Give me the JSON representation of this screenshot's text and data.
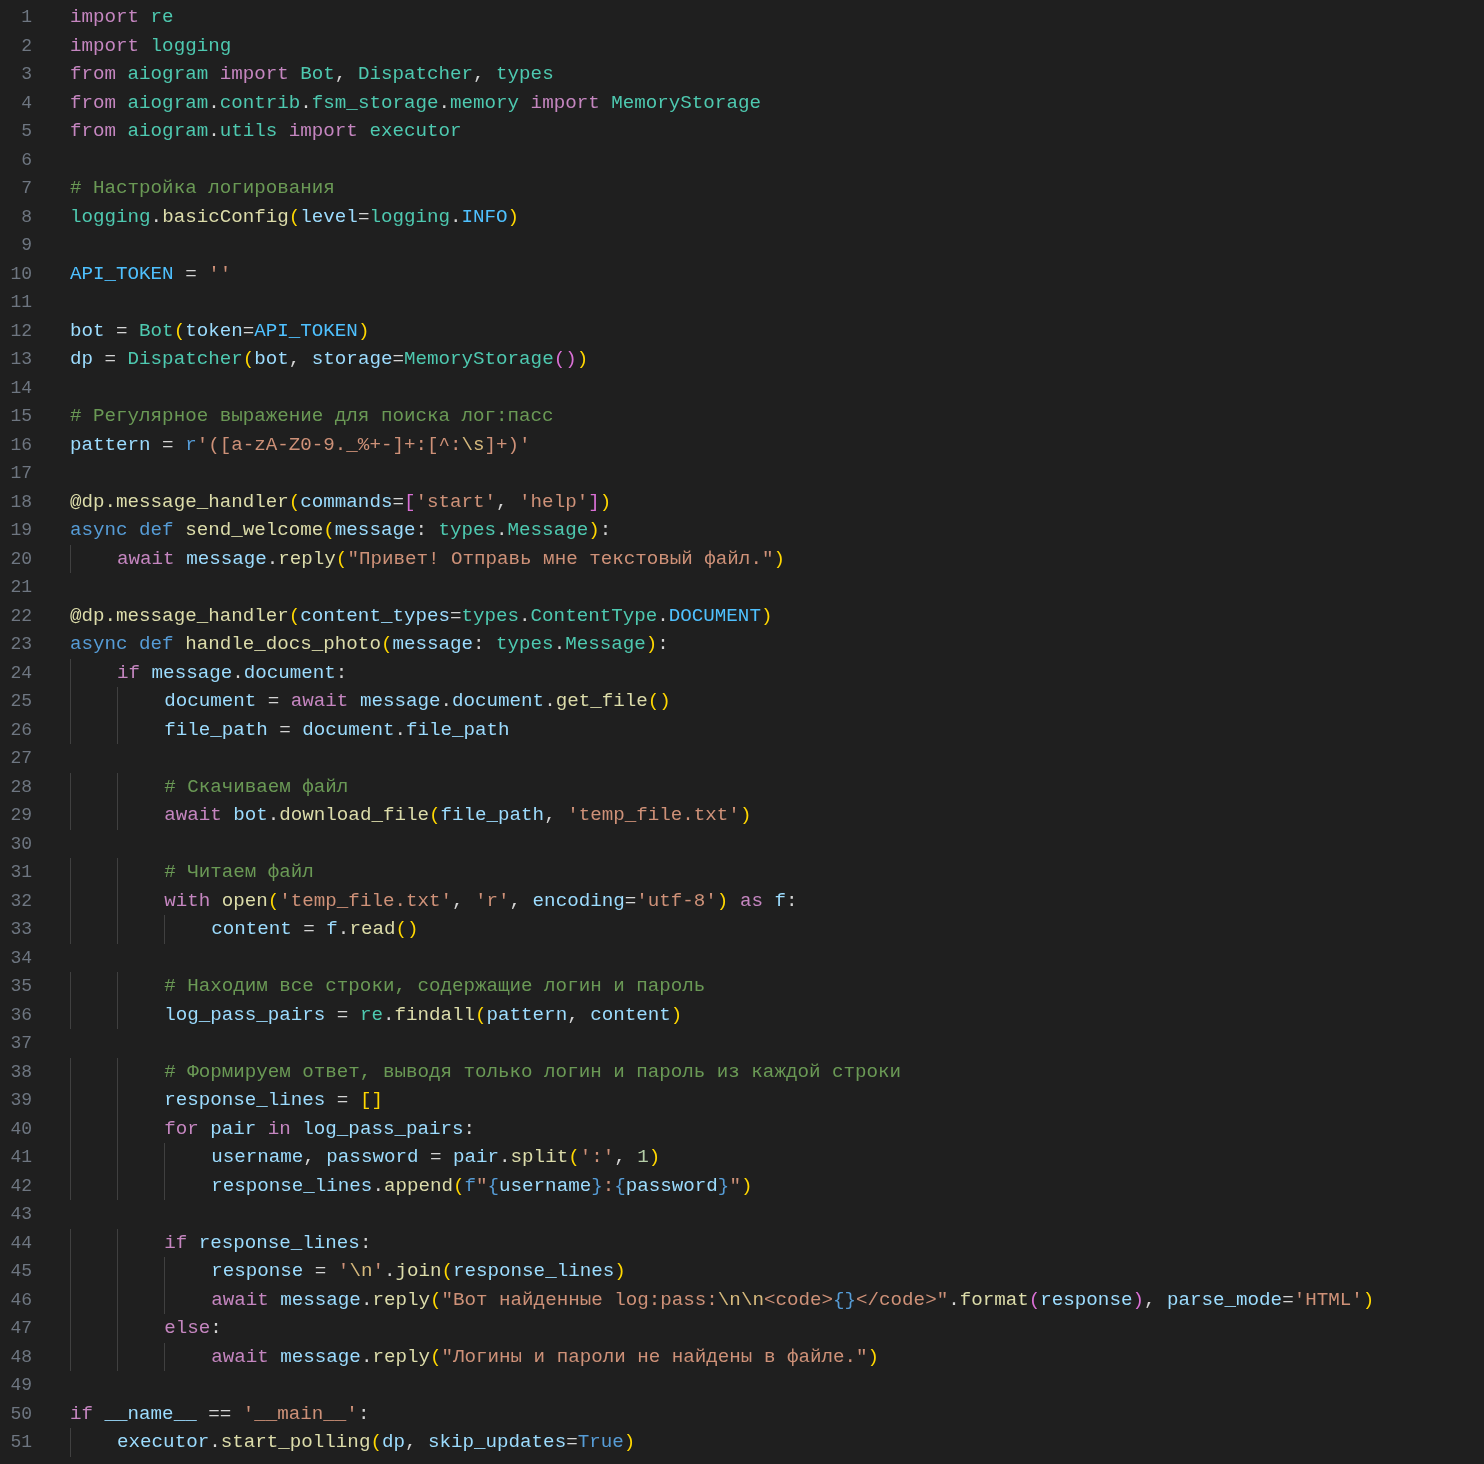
{
  "editor": {
    "lines": [
      {
        "number": "1",
        "tokens": [
          {
            "kind": "kw",
            "text": "import"
          },
          {
            "kind": "cls",
            "text": " re"
          }
        ]
      },
      {
        "number": "2",
        "tokens": [
          {
            "kind": "kw",
            "text": "import"
          },
          {
            "kind": "cls",
            "text": " logging"
          }
        ]
      },
      {
        "number": "3",
        "tokens": [
          {
            "kind": "kw",
            "text": "from"
          },
          {
            "kind": "cls",
            "text": " aiogram"
          },
          {
            "kind": "kw",
            "text": " import"
          },
          {
            "kind": "cls",
            "text": " Bot"
          },
          {
            "kind": "op",
            "text": ", "
          },
          {
            "kind": "cls",
            "text": "Dispatcher"
          },
          {
            "kind": "op",
            "text": ", "
          },
          {
            "kind": "cls",
            "text": "types"
          }
        ]
      },
      {
        "number": "4",
        "tokens": [
          {
            "kind": "kw",
            "text": "from"
          },
          {
            "kind": "cls",
            "text": " aiogram"
          },
          {
            "kind": "op",
            "text": "."
          },
          {
            "kind": "cls",
            "text": "contrib"
          },
          {
            "kind": "op",
            "text": "."
          },
          {
            "kind": "cls",
            "text": "fsm_storage"
          },
          {
            "kind": "op",
            "text": "."
          },
          {
            "kind": "cls",
            "text": "memory"
          },
          {
            "kind": "kw",
            "text": " import"
          },
          {
            "kind": "cls",
            "text": " MemoryStorage"
          }
        ]
      },
      {
        "number": "5",
        "tokens": [
          {
            "kind": "kw",
            "text": "from"
          },
          {
            "kind": "cls",
            "text": " aiogram"
          },
          {
            "kind": "op",
            "text": "."
          },
          {
            "kind": "cls",
            "text": "utils"
          },
          {
            "kind": "kw",
            "text": " import"
          },
          {
            "kind": "cls",
            "text": " executor"
          }
        ]
      },
      {
        "number": "6"
      },
      {
        "number": "7",
        "tokens": [
          {
            "kind": "cmt",
            "text": "# Настройка логирования"
          }
        ]
      },
      {
        "number": "8",
        "tokens": [
          {
            "kind": "cls",
            "text": "logging"
          },
          {
            "kind": "op",
            "text": "."
          },
          {
            "kind": "fn",
            "text": "basicConfig"
          },
          {
            "kind": "br1",
            "text": "("
          },
          {
            "kind": "var",
            "text": "level"
          },
          {
            "kind": "op",
            "text": "="
          },
          {
            "kind": "cls",
            "text": "logging"
          },
          {
            "kind": "op",
            "text": "."
          },
          {
            "kind": "const",
            "text": "INFO"
          },
          {
            "kind": "br1",
            "text": ")"
          }
        ]
      },
      {
        "number": "9"
      },
      {
        "number": "10",
        "tokens": [
          {
            "kind": "const",
            "text": "API_TOKEN"
          },
          {
            "kind": "op",
            "text": " = "
          },
          {
            "kind": "str",
            "text": "''"
          }
        ]
      },
      {
        "number": "11"
      },
      {
        "number": "12",
        "tokens": [
          {
            "kind": "var",
            "text": "bot"
          },
          {
            "kind": "op",
            "text": " = "
          },
          {
            "kind": "cls",
            "text": "Bot"
          },
          {
            "kind": "br1",
            "text": "("
          },
          {
            "kind": "var",
            "text": "token"
          },
          {
            "kind": "op",
            "text": "="
          },
          {
            "kind": "const",
            "text": "API_TOKEN"
          },
          {
            "kind": "br1",
            "text": ")"
          }
        ]
      },
      {
        "number": "13",
        "tokens": [
          {
            "kind": "var",
            "text": "dp"
          },
          {
            "kind": "op",
            "text": " = "
          },
          {
            "kind": "cls",
            "text": "Dispatcher"
          },
          {
            "kind": "br1",
            "text": "("
          },
          {
            "kind": "var",
            "text": "bot"
          },
          {
            "kind": "op",
            "text": ", "
          },
          {
            "kind": "var",
            "text": "storage"
          },
          {
            "kind": "op",
            "text": "="
          },
          {
            "kind": "cls",
            "text": "MemoryStorage"
          },
          {
            "kind": "br2",
            "text": "()"
          },
          {
            "kind": "br1",
            "text": ")"
          }
        ]
      },
      {
        "number": "14"
      },
      {
        "number": "15",
        "tokens": [
          {
            "kind": "cmt",
            "text": "# Регулярное выражение для поиска лог:пасс"
          }
        ]
      },
      {
        "number": "16",
        "tokens": [
          {
            "kind": "var",
            "text": "pattern"
          },
          {
            "kind": "op",
            "text": " = "
          },
          {
            "kind": "store",
            "text": "r"
          },
          {
            "kind": "str",
            "text": "'([a-zA-Z0-9._%+-]+:[^:"
          },
          {
            "kind": "esc",
            "text": "\\s"
          },
          {
            "kind": "str",
            "text": "]+)'"
          }
        ]
      },
      {
        "number": "17"
      },
      {
        "number": "18",
        "tokens": [
          {
            "kind": "fn",
            "text": "@dp.message_handler"
          },
          {
            "kind": "br1",
            "text": "("
          },
          {
            "kind": "var",
            "text": "commands"
          },
          {
            "kind": "op",
            "text": "="
          },
          {
            "kind": "br2",
            "text": "["
          },
          {
            "kind": "str",
            "text": "'start'"
          },
          {
            "kind": "op",
            "text": ", "
          },
          {
            "kind": "str",
            "text": "'help'"
          },
          {
            "kind": "br2",
            "text": "]"
          },
          {
            "kind": "br1",
            "text": ")"
          }
        ]
      },
      {
        "number": "19",
        "tokens": [
          {
            "kind": "store",
            "text": "async def"
          },
          {
            "kind": "fn",
            "text": " send_welcome"
          },
          {
            "kind": "br1",
            "text": "("
          },
          {
            "kind": "var",
            "text": "message"
          },
          {
            "kind": "op",
            "text": ": "
          },
          {
            "kind": "cls",
            "text": "types"
          },
          {
            "kind": "op",
            "text": "."
          },
          {
            "kind": "cls",
            "text": "Message"
          },
          {
            "kind": "br1",
            "text": ")"
          },
          {
            "kind": "op",
            "text": ":"
          }
        ]
      },
      {
        "number": "20",
        "tokens": [
          {
            "kind": "kw",
            "text": "    await"
          },
          {
            "kind": "var",
            "text": " message"
          },
          {
            "kind": "op",
            "text": "."
          },
          {
            "kind": "fn",
            "text": "reply"
          },
          {
            "kind": "br1",
            "text": "("
          },
          {
            "kind": "str",
            "text": "\"Привет! Отправь мне текстовый файл.\""
          },
          {
            "kind": "br1",
            "text": ")"
          }
        ]
      },
      {
        "number": "21"
      },
      {
        "number": "22",
        "tokens": [
          {
            "kind": "fn",
            "text": "@dp.message_handler"
          },
          {
            "kind": "br1",
            "text": "("
          },
          {
            "kind": "var",
            "text": "content_types"
          },
          {
            "kind": "op",
            "text": "="
          },
          {
            "kind": "cls",
            "text": "types"
          },
          {
            "kind": "op",
            "text": "."
          },
          {
            "kind": "cls",
            "text": "ContentType"
          },
          {
            "kind": "op",
            "text": "."
          },
          {
            "kind": "const",
            "text": "DOCUMENT"
          },
          {
            "kind": "br1",
            "text": ")"
          }
        ]
      },
      {
        "number": "23",
        "tokens": [
          {
            "kind": "store",
            "text": "async def"
          },
          {
            "kind": "fn",
            "text": " handle_docs_photo"
          },
          {
            "kind": "br1",
            "text": "("
          },
          {
            "kind": "var",
            "text": "message"
          },
          {
            "kind": "op",
            "text": ": "
          },
          {
            "kind": "cls",
            "text": "types"
          },
          {
            "kind": "op",
            "text": "."
          },
          {
            "kind": "cls",
            "text": "Message"
          },
          {
            "kind": "br1",
            "text": ")"
          },
          {
            "kind": "op",
            "text": ":"
          }
        ]
      },
      {
        "number": "24",
        "tokens": [
          {
            "kind": "kw",
            "text": "    if"
          },
          {
            "kind": "var",
            "text": " message"
          },
          {
            "kind": "op",
            "text": "."
          },
          {
            "kind": "var",
            "text": "document"
          },
          {
            "kind": "op",
            "text": ":"
          }
        ]
      },
      {
        "number": "25",
        "tokens": [
          {
            "kind": "var",
            "text": "        document"
          },
          {
            "kind": "op",
            "text": " = "
          },
          {
            "kind": "kw",
            "text": "await"
          },
          {
            "kind": "var",
            "text": " message"
          },
          {
            "kind": "op",
            "text": "."
          },
          {
            "kind": "var",
            "text": "document"
          },
          {
            "kind": "op",
            "text": "."
          },
          {
            "kind": "fn",
            "text": "get_file"
          },
          {
            "kind": "br1",
            "text": "()"
          }
        ]
      },
      {
        "number": "26",
        "tokens": [
          {
            "kind": "var",
            "text": "        file_path"
          },
          {
            "kind": "op",
            "text": " = "
          },
          {
            "kind": "var",
            "text": "document"
          },
          {
            "kind": "op",
            "text": "."
          },
          {
            "kind": "var",
            "text": "file_path"
          }
        ]
      },
      {
        "number": "27"
      },
      {
        "number": "28",
        "tokens": [
          {
            "kind": "cmt",
            "text": "        # Скачиваем файл"
          }
        ]
      },
      {
        "number": "29",
        "tokens": [
          {
            "kind": "kw",
            "text": "        await"
          },
          {
            "kind": "var",
            "text": " bot"
          },
          {
            "kind": "op",
            "text": "."
          },
          {
            "kind": "fn",
            "text": "download_file"
          },
          {
            "kind": "br1",
            "text": "("
          },
          {
            "kind": "var",
            "text": "file_path"
          },
          {
            "kind": "op",
            "text": ", "
          },
          {
            "kind": "str",
            "text": "'temp_file.txt'"
          },
          {
            "kind": "br1",
            "text": ")"
          }
        ]
      },
      {
        "number": "30"
      },
      {
        "number": "31",
        "tokens": [
          {
            "kind": "cmt",
            "text": "        # Читаем файл"
          }
        ]
      },
      {
        "number": "32",
        "tokens": [
          {
            "kind": "kw",
            "text": "        with"
          },
          {
            "kind": "fn",
            "text": " open"
          },
          {
            "kind": "br1",
            "text": "("
          },
          {
            "kind": "str",
            "text": "'temp_file.txt'"
          },
          {
            "kind": "op",
            "text": ", "
          },
          {
            "kind": "str",
            "text": "'r'"
          },
          {
            "kind": "op",
            "text": ", "
          },
          {
            "kind": "var",
            "text": "encoding"
          },
          {
            "kind": "op",
            "text": "="
          },
          {
            "kind": "str",
            "text": "'utf-8'"
          },
          {
            "kind": "br1",
            "text": ")"
          },
          {
            "kind": "kw",
            "text": " as"
          },
          {
            "kind": "var",
            "text": " f"
          },
          {
            "kind": "op",
            "text": ":"
          }
        ]
      },
      {
        "number": "33",
        "tokens": [
          {
            "kind": "var",
            "text": "            content"
          },
          {
            "kind": "op",
            "text": " = "
          },
          {
            "kind": "var",
            "text": "f"
          },
          {
            "kind": "op",
            "text": "."
          },
          {
            "kind": "fn",
            "text": "read"
          },
          {
            "kind": "br1",
            "text": "()"
          }
        ]
      },
      {
        "number": "34"
      },
      {
        "number": "35",
        "tokens": [
          {
            "kind": "cmt",
            "text": "        # Находим все строки, содержащие логин и пароль"
          }
        ]
      },
      {
        "number": "36",
        "tokens": [
          {
            "kind": "var",
            "text": "        log_pass_pairs"
          },
          {
            "kind": "op",
            "text": " = "
          },
          {
            "kind": "cls",
            "text": "re"
          },
          {
            "kind": "op",
            "text": "."
          },
          {
            "kind": "fn",
            "text": "findall"
          },
          {
            "kind": "br1",
            "text": "("
          },
          {
            "kind": "var",
            "text": "pattern"
          },
          {
            "kind": "op",
            "text": ", "
          },
          {
            "kind": "var",
            "text": "content"
          },
          {
            "kind": "br1",
            "text": ")"
          }
        ]
      },
      {
        "number": "37"
      },
      {
        "number": "38",
        "tokens": [
          {
            "kind": "cmt",
            "text": "        # Формируем ответ, выводя только логин и пароль из каждой строки"
          }
        ]
      },
      {
        "number": "39",
        "tokens": [
          {
            "kind": "var",
            "text": "        response_lines"
          },
          {
            "kind": "op",
            "text": " = "
          },
          {
            "kind": "br1",
            "text": "[]"
          }
        ]
      },
      {
        "number": "40",
        "tokens": [
          {
            "kind": "kw",
            "text": "        for"
          },
          {
            "kind": "var",
            "text": " pair"
          },
          {
            "kind": "kw",
            "text": " in"
          },
          {
            "kind": "var",
            "text": " log_pass_pairs"
          },
          {
            "kind": "op",
            "text": ":"
          }
        ]
      },
      {
        "number": "41",
        "tokens": [
          {
            "kind": "var",
            "text": "            username"
          },
          {
            "kind": "op",
            "text": ", "
          },
          {
            "kind": "var",
            "text": "password"
          },
          {
            "kind": "op",
            "text": " = "
          },
          {
            "kind": "var",
            "text": "pair"
          },
          {
            "kind": "op",
            "text": "."
          },
          {
            "kind": "fn",
            "text": "split"
          },
          {
            "kind": "br1",
            "text": "("
          },
          {
            "kind": "str",
            "text": "':'"
          },
          {
            "kind": "op",
            "text": ", "
          },
          {
            "kind": "num",
            "text": "1"
          },
          {
            "kind": "br1",
            "text": ")"
          }
        ]
      },
      {
        "number": "42",
        "tokens": [
          {
            "kind": "var",
            "text": "            response_lines"
          },
          {
            "kind": "op",
            "text": "."
          },
          {
            "kind": "fn",
            "text": "append"
          },
          {
            "kind": "br1",
            "text": "("
          },
          {
            "kind": "store",
            "text": "f"
          },
          {
            "kind": "str",
            "text": "\""
          },
          {
            "kind": "store",
            "text": "{"
          },
          {
            "kind": "var",
            "text": "username"
          },
          {
            "kind": "store",
            "text": "}"
          },
          {
            "kind": "str",
            "text": ":"
          },
          {
            "kind": "store",
            "text": "{"
          },
          {
            "kind": "var",
            "text": "password"
          },
          {
            "kind": "store",
            "text": "}"
          },
          {
            "kind": "str",
            "text": "\""
          },
          {
            "kind": "br1",
            "text": ")"
          }
        ]
      },
      {
        "number": "43"
      },
      {
        "number": "44",
        "tokens": [
          {
            "kind": "kw",
            "text": "        if"
          },
          {
            "kind": "var",
            "text": " response_lines"
          },
          {
            "kind": "op",
            "text": ":"
          }
        ]
      },
      {
        "number": "45",
        "tokens": [
          {
            "kind": "var",
            "text": "            response"
          },
          {
            "kind": "op",
            "text": " = "
          },
          {
            "kind": "str",
            "text": "'"
          },
          {
            "kind": "esc",
            "text": "\\n"
          },
          {
            "kind": "str",
            "text": "'"
          },
          {
            "kind": "op",
            "text": "."
          },
          {
            "kind": "fn",
            "text": "join"
          },
          {
            "kind": "br1",
            "text": "("
          },
          {
            "kind": "var",
            "text": "response_lines"
          },
          {
            "kind": "br1",
            "text": ")"
          }
        ]
      },
      {
        "number": "46",
        "tokens": [
          {
            "kind": "kw",
            "text": "            await"
          },
          {
            "kind": "var",
            "text": " message"
          },
          {
            "kind": "op",
            "text": "."
          },
          {
            "kind": "fn",
            "text": "reply"
          },
          {
            "kind": "br1",
            "text": "("
          },
          {
            "kind": "str",
            "text": "\"Вот найденные log:pass:"
          },
          {
            "kind": "esc",
            "text": "\\n\\n"
          },
          {
            "kind": "str",
            "text": "<code>"
          },
          {
            "kind": "store",
            "text": "{}"
          },
          {
            "kind": "str",
            "text": "</code>\""
          },
          {
            "kind": "op",
            "text": "."
          },
          {
            "kind": "fn",
            "text": "format"
          },
          {
            "kind": "br2",
            "text": "("
          },
          {
            "kind": "var",
            "text": "response"
          },
          {
            "kind": "br2",
            "text": ")"
          },
          {
            "kind": "op",
            "text": ", "
          },
          {
            "kind": "var",
            "text": "parse_mode"
          },
          {
            "kind": "op",
            "text": "="
          },
          {
            "kind": "str",
            "text": "'HTML'"
          },
          {
            "kind": "br1",
            "text": ")"
          }
        ]
      },
      {
        "number": "47",
        "tokens": [
          {
            "kind": "kw",
            "text": "        else"
          },
          {
            "kind": "op",
            "text": ":"
          }
        ]
      },
      {
        "number": "48",
        "tokens": [
          {
            "kind": "kw",
            "text": "            await"
          },
          {
            "kind": "var",
            "text": " message"
          },
          {
            "kind": "op",
            "text": "."
          },
          {
            "kind": "fn",
            "text": "reply"
          },
          {
            "kind": "br1",
            "text": "("
          },
          {
            "kind": "str",
            "text": "\"Логины и пароли не найдены в файле.\""
          },
          {
            "kind": "br1",
            "text": ")"
          }
        ]
      },
      {
        "number": "49"
      },
      {
        "number": "50",
        "tokens": [
          {
            "kind": "kw",
            "text": "if"
          },
          {
            "kind": "var",
            "text": " __name__"
          },
          {
            "kind": "op",
            "text": " == "
          },
          {
            "kind": "str",
            "text": "'__main__'"
          },
          {
            "kind": "op",
            "text": ":"
          }
        ]
      },
      {
        "number": "51",
        "tokens": [
          {
            "kind": "var",
            "text": "    executor"
          },
          {
            "kind": "op",
            "text": "."
          },
          {
            "kind": "fn",
            "text": "start_polling"
          },
          {
            "kind": "br1",
            "text": "("
          },
          {
            "kind": "var",
            "text": "dp"
          },
          {
            "kind": "op",
            "text": ", "
          },
          {
            "kind": "var",
            "text": "skip_updates"
          },
          {
            "kind": "op",
            "text": "="
          },
          {
            "kind": "store",
            "text": "True"
          },
          {
            "kind": "br1",
            "text": ")"
          }
        ]
      }
    ]
  }
}
